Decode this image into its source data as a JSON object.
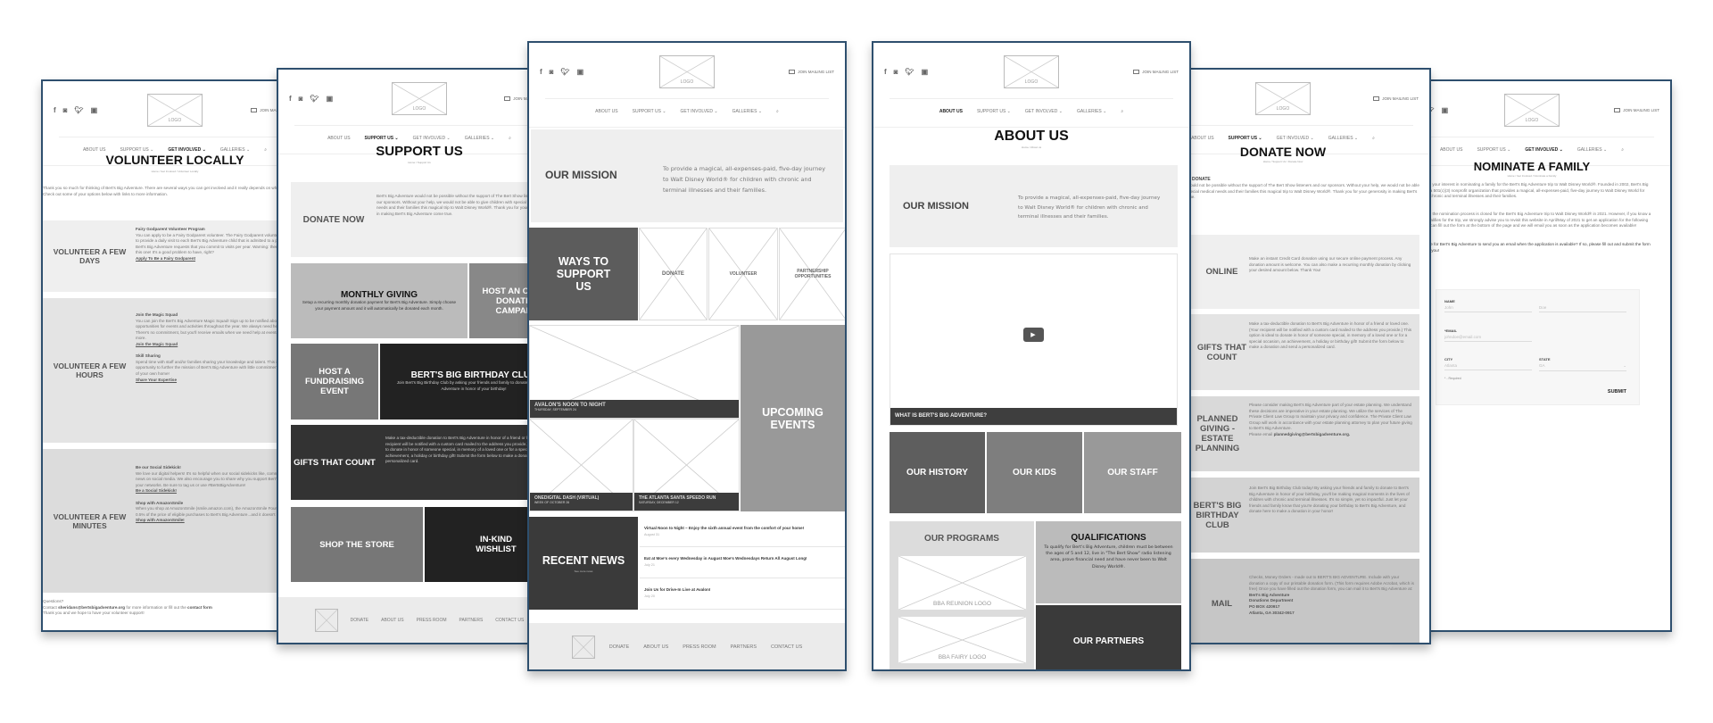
{
  "common": {
    "social_icons": [
      "facebook-icon",
      "instagram-icon",
      "twitter-icon",
      "youtube-icon"
    ],
    "logo": "LOGO",
    "mailing": "JOIN MAILING LIST",
    "nav": [
      "ABOUT US",
      "SUPPORT US",
      "GET INVOLVED",
      "GALLERIES"
    ],
    "footer": [
      "DONATE",
      "ABOUT US",
      "PRESS ROOM",
      "PARTNERS",
      "CONTACT US"
    ],
    "border_color": "#2e4f6e"
  },
  "home": {
    "mission_title": "OUR MISSION",
    "mission_text": "To provide a magical, all-expenses-paid, five-day journey to Walt Disney World® for children with chronic and terminal illnesses and their families.",
    "ways_title": "WAYS TO SUPPORT US",
    "ways": [
      "DONATE",
      "VOLUNTEER",
      "PARTNERSHIP OPPORTUNITIES"
    ],
    "events": [
      {
        "name": "AVALON'S NOON TO NIGHT",
        "date": "THURSDAY, SEPTEMBER 24"
      },
      {
        "name": "ONEDIGITAL DASH (VIRTUAL)",
        "date": "WEEK OF OCTOBER 26"
      },
      {
        "name": "THE ATLANTA SANTA SPEEDO RUN",
        "date": "SATURDAY, DECEMBER 12"
      }
    ],
    "events_title": "UPCOMING EVENTS",
    "news_title": "RECENT NEWS",
    "news_more": "See more news",
    "news": [
      {
        "title": "Virtual Noon to Night – Enjoy the sixth annual event from the comfort of your home!",
        "date": "August 31"
      },
      {
        "title": "Eat at Moe's every Wednesday in August Moe's Wednesdays Return All August Long!",
        "date": "July 21"
      },
      {
        "title": "Join Us for Drive-In Live at Avalon!",
        "date": "July 20"
      }
    ]
  },
  "about": {
    "title": "ABOUT US",
    "breadcrumb": "Home / About us",
    "mission_title": "OUR MISSION",
    "mission_text": "To provide a magical, all-expenses-paid, five-day journey to Walt Disney World® for children with chronic and terminal illnesses and their families.",
    "video_caption": "WHAT IS BERT'S BIG ADVENTURE?",
    "tiles": [
      "OUR HISTORY",
      "OUR KIDS",
      "OUR STAFF"
    ],
    "programs_title": "OUR PROGRAMS",
    "programs": [
      "BBA REUNION LOGO",
      "BBA FAIRY LOGO"
    ],
    "qual_title": "QUALIFICATIONS",
    "qual_text": "To qualify for Bert's Big Adventure, children must be between the ages of 5 and 12, live in \"The Bert Show\" radio listening area, prove financial need and have never been to Walt Disney World®.",
    "partners": "OUR PARTNERS"
  },
  "support": {
    "title": "SUPPORT US",
    "breadcrumb": "Home / Support Us",
    "donate_title": "DONATE NOW",
    "donate_text": "Bert's Big Adventure would not be possible without the support of The Bert Show listeners and our sponsors. Without your help, we would not be able to give children with special medical needs and their families this magical trip to Walt Disney World®. Thank you for your generosity in making Bert's Big Adventure come true.",
    "monthly_title": "MONTHLY GIVING",
    "monthly_text": "Setup a recurring monthly donation payment for Bert's Big Adventure. Simply choose your payment amount and it will automatically be donated each month.",
    "online": "HOST AN ONLINE DONATION CAMPAIGN",
    "host": "HOST A FUNDRAISING EVENT",
    "birthday_title": "BERT'S BIG BIRTHDAY CLUB",
    "birthday_text": "Join Bert's Big Birthday Club by asking your friends and family to donate to Bert's Big Adventure in honor of your birthday!",
    "gifts_title": "GIFTS THAT COUNT",
    "gifts_text": "Make a tax-deductible donation to Bert's Big Adventure in honor of a friend or loved one. (Your recipient will be notified with a custom card mailed to the address you provide.) This option is ideal to donate in honor of someone special, in memory of a loved one or for a special occasion, an achievement, a holiday or birthday gift! Submit the form below to make a donation and send a personalized card.",
    "shop": "SHOP THE STORE",
    "wishlist": "IN-KIND WISHLIST"
  },
  "volunteer": {
    "title": "VOLUNTEER LOCALLY",
    "breadcrumb": "Home / Get Involved / Volunteer Locally",
    "intro": "Thank you so much for thinking of Bert's Big Adventure. There are several ways you can get involved and it really depends on what you are looking for! Check out some of your options below with links to more information.",
    "sections": [
      {
        "label": "VOLUNTEER A FEW DAYS",
        "items": [
          {
            "title": "Fairy Godparent Volunteer Program",
            "text": "You can apply to be a Fairy Godparent volunteer. The Fairy Godparent volunteer program strives to provide a daily visit to each Bert's Big Adventure child that is admitted to a partner hospital. Bert's Big Adventure requests that you commit to visits per year. Warning: there is a waiting list for this one! It's a good problem to have, right?",
            "link": "Apply To Be a Fairy Godparent"
          }
        ]
      },
      {
        "label": "VOLUNTEER A FEW HOURS",
        "items": [
          {
            "title": "Join the Magic Squad",
            "text": "You can join the Bert's Big Adventure Magic Squad! Sign up to be notified about volunteer opportunities for events and activities throughout the year. We always need helping hands! There's no commitment, but you'll receive emails when we need help at events, in the office, and more.",
            "link": "Join the Magic Squad"
          },
          {
            "title": "Skill Sharing",
            "text": "Spend time with staff and/or families sharing your knowledge and talent. This is a great opportunity to further the mission of Bert's Big Adventure with little commitment and in the comfort of your own home!",
            "link": "Share Your Expertise"
          }
        ]
      },
      {
        "label": "VOLUNTEER A FEW MINUTES",
        "items": [
          {
            "title": "Be our Social Sidekick!",
            "text": "We love our digital helpers! It's so helpful when our social sidekicks like, comment, and share our news on social media. We also encourage you to share why you support Bert's Big Adventure with your networks. Be sure to tag us or use #BertsBigAdventure!",
            "link": "Be a Social Sidekick!"
          },
          {
            "title": "Shop with AmazonSmile",
            "text": "When you shop at AmazonSmile (smile.amazon.com), the AmazonSmile Foundation will donate 0.5% of the price of eligible purchases to Bert's Big Adventure...and it doesn't cost you anything!",
            "link": "Shop with AmazonSmile!"
          }
        ]
      }
    ],
    "questions": "Questions?",
    "contact_pre": "Contact",
    "contact_email": "sheridans@bertsbigadventure.org",
    "contact_mid": "for more information or fill out the",
    "contact_form": "contact form",
    "thanks": "Thank you and we hope to have your volunteer support!"
  },
  "donate": {
    "title": "DONATE NOW",
    "breadcrumb": "Home / Support Us / Donate Now",
    "heading": "DONATE",
    "intro": "Bert's Big Adventure would not be possible without the support of The Bert Show listeners and our sponsors. Without your help, we would not be able to give children with special medical needs and their families this magical trip to Walt Disney World®. Thank you for your generosity in making Bert's Big Adventure come true.",
    "sections": [
      {
        "label": "ONLINE",
        "text": "Make an instant Credit Card donation using our secure online payment process. Any donation amount is welcome. You can also make a recurring monthly donation by clicking your desired amount below. Thank You!"
      },
      {
        "label": "GIFTS THAT COUNT",
        "text": "Make a tax-deductible donation to Bert's Big Adventure in honor of a friend or loved one. (Your recipient will be notified with a custom card mailed to the address you provide.) This option is ideal to donate in honor of someone special, in memory of a loved one or for a special occasion, an achievement, a holiday or birthday gift! Submit the form below to make a donation and send a personalized card."
      },
      {
        "label": "PLANNED GIVING - ESTATE PLANNING",
        "text": "Please consider making Bert's Big Adventure part of your estate planning. We understand these decisions are imperative in your estate planning. We utilize the services of The Private Client Law Group to maintain your privacy and confidence. The Private Client Law Group will work in accordance with your estate planning attorney to plan your future giving to Bert's Big Adventure.",
        "email_pre": "Please email",
        "email": "plannedgiving@bertsbigadventure.org."
      },
      {
        "label": "BERT'S BIG BIRTHDAY CLUB",
        "text": "Join Bert's Big Birthday Club today! By asking your friends and family to donate to Bert's Big Adventure in honor of your birthday, you'll be making magical moments in the lives of children with chronic and terminal illnesses. It's so simple, yet so impactful. Just let your friends and family know that you're donating your birthday to Bert's Big Adventure, and donate here to make a donation in your honor!"
      },
      {
        "label": "MAIL",
        "text": "Checks, Money Orders - made out to BERT'S BIG ADVENTURE. Include with your donation a copy of our printable donation form. (This form requires Adobe Acrobat, which is free) Once you have filled out the donation form, you can mail it to Bert's Big Adventure at:",
        "address": [
          "Bert's Big Adventure",
          "Donations Department",
          "PO BOX 420917",
          "Atlanta, GA 30342-0917"
        ]
      }
    ]
  },
  "nominate": {
    "title": "NOMINATE A FAMILY",
    "breadcrumb": "Home / Get Involved / Nominate a Family",
    "p1": "Thank you for your interest in nominating a family for the Bert's Big Adventure trip to Walt Disney World®. Founded in 2002, Bert's Big Adventure is a 501(c)(3) nonprofit organization that provides a magical, all-expenses-paid, five-day journey to Walt Disney World for children with chronic and terminal illnesses and their families.",
    "p2": "Unfortunately, the nomination process is closed for the Bert's Big Adventure trip to Walt Disney World® in 2021. However, if you know a family that qualifies for the trip, we strongly advise you to revisit this website in April/May of 2021 to get an application for the following year. Or, you can fill out the form at the bottom of the page and we will email you as soon as the application becomes available!",
    "p3": "Would you like for Bert's Big Adventure to send you an email when the application is available? If so, please fill out and submit the form below. Thank you!",
    "form": {
      "name_label": "NAME",
      "first_placeholder": "John",
      "last_placeholder": "Doe",
      "email_label": "*EMAIL",
      "email_placeholder": "johndoe@email.com",
      "city_label": "CITY",
      "city_placeholder": "Atlanta",
      "state_label": "STATE",
      "state_value": "GA",
      "required": "* - Required",
      "submit": "SUBMIT"
    }
  }
}
